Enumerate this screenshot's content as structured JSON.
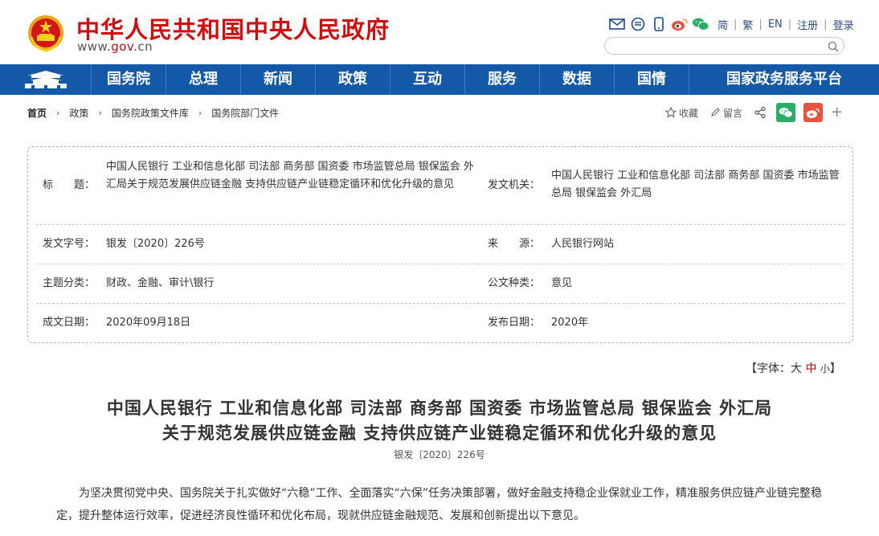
{
  "header": {
    "site_title": "中华人民共和国中央人民政府",
    "url_prefix": "www.",
    "url_domain": "gov",
    "url_suffix": ".cn",
    "lang_links": [
      "简",
      "繁",
      "EN",
      "注册",
      "登录"
    ]
  },
  "nav": {
    "items": [
      "国务院",
      "总理",
      "新闻",
      "政策",
      "互动",
      "服务",
      "数据",
      "国情",
      "国家政务服务平台"
    ]
  },
  "breadcrumb": [
    "首页",
    "政策",
    "国务院政策文件库",
    "国务院部门文件"
  ],
  "share": {
    "favorite_label": "收藏",
    "comment_label": "留言"
  },
  "info": {
    "title_label": "标　　题：",
    "title_value": "中国人民银行 工业和信息化部 司法部 商务部 国资委 市场监管总局 银保监会 外汇局关于规范发展供应链金融 支持供应链产业链稳定循环和优化升级的意见",
    "issuer_label": "发文机关：",
    "issuer_value": "中国人民银行 工业和信息化部 司法部 商务部 国资委 市场监管总局 银保监会 外汇局",
    "doc_no_label": "发文字号：",
    "doc_no_value": "银发〔2020〕226号",
    "source_label": "来　　源：",
    "source_value": "人民银行网站",
    "topic_label": "主题分类：",
    "topic_value": "财政、金融、审计\\银行",
    "type_label": "公文种类：",
    "type_value": "意见",
    "created_label": "成文日期：",
    "created_value": "2020年09月18日",
    "published_label": "发布日期：",
    "published_value": "2020年"
  },
  "font_size": {
    "prefix": "【字体：",
    "large": "大",
    "medium": "中",
    "small": "小",
    "suffix": "】"
  },
  "document": {
    "title_line1": "中国人民银行 工业和信息化部 司法部 商务部 国资委 市场监管总局 银保监会 外汇局",
    "title_line2": "关于规范发展供应链金融 支持供应链产业链稳定循环和优化升级的意见",
    "number": "银发〔2020〕226号",
    "paragraph1": "为坚决贯彻党中央、国务院关于扎实做好“六稳”工作、全面落实“六保”任务决策部署，做好金融支持稳企业保就业工作，精准服务供应链产业链完整稳定，提升整体运行效率，促进经济良性循环和优化布局，现就供应链金融规范、发展和创新提出以下意见。"
  },
  "colors": {
    "brand_red": "#d10d0d",
    "nav_blue": "#1458a8",
    "wechat_green": "#2aae67",
    "weibo_red": "#e6533f"
  },
  "icons": [
    "national-emblem-icon",
    "mail-icon",
    "chat-icon",
    "mobile-icon",
    "weibo-icon",
    "wechat-icon",
    "search-icon",
    "tiananmen-icon",
    "star-icon",
    "pen-icon",
    "share-icon",
    "plus-icon"
  ]
}
